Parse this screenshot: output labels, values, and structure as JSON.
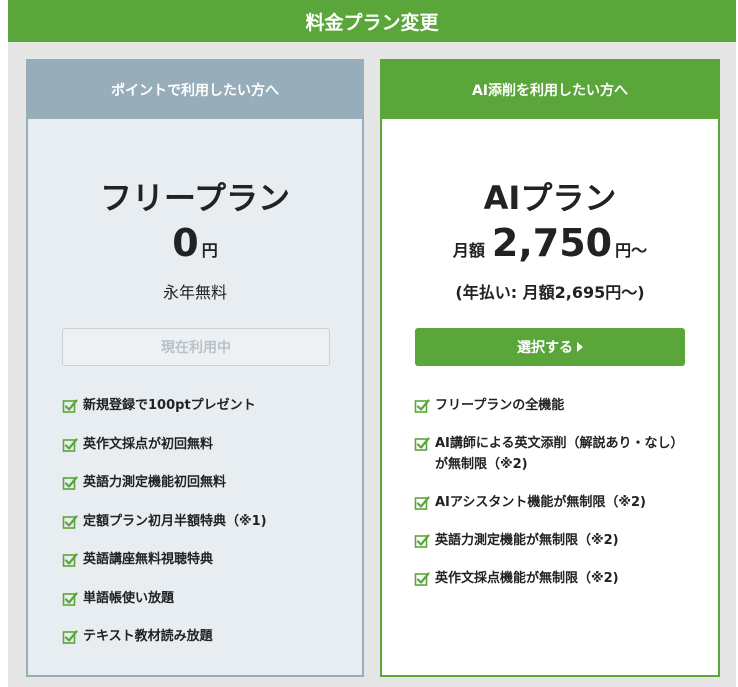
{
  "header": {
    "title": "料金プラン変更"
  },
  "free_plan": {
    "head": "ポイントで利用したい方へ",
    "name": "フリープラン",
    "price": "0",
    "unit": "円",
    "note": "永年無料",
    "status_label": "現在利用中",
    "features": [
      "新規登録で100ptプレゼント",
      "英作文採点が初回無料",
      "英語力測定機能初回無料",
      "定額プラン初月半額特典（※1)",
      "英語講座無料視聴特典",
      "単語帳使い放題",
      "テキスト教材読み放題"
    ]
  },
  "ai_plan": {
    "head": "AI添削を利用したい方へ",
    "name": "AIプラン",
    "price_prefix": "月額",
    "price": "2,750",
    "unit": "円〜",
    "note": "(年払い: 月額2,695円〜)",
    "select_label": "選択する",
    "features": [
      "フリープランの全機能",
      "AI講師による英文添削（解説あり・なし）が無制限（※2)",
      "AIアシスタント機能が無制限（※2)",
      "英語力測定機能が無制限（※2)",
      "英作文採点機能が無制限（※2)"
    ]
  },
  "colors": {
    "accent_green": "#5aa63a",
    "free_header": "#97adb9",
    "free_body": "#e8edf1",
    "background": "#e5e5e5"
  },
  "icons": {
    "feature_check": "checkbox-check-icon",
    "button_arrow": "triangle-right-icon"
  }
}
